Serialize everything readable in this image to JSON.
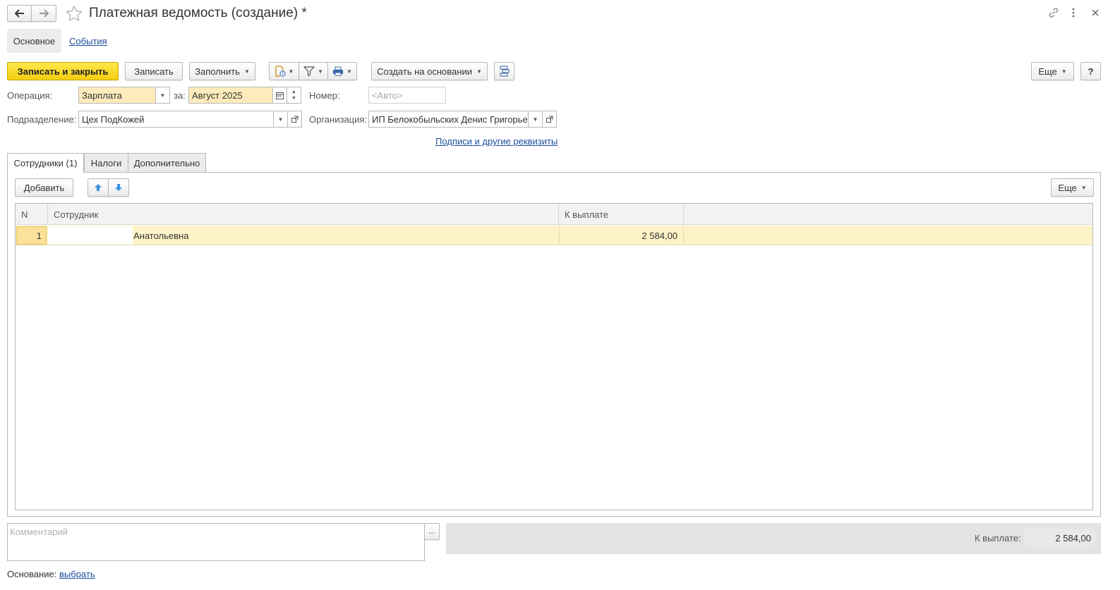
{
  "window": {
    "title": "Платежная ведомость (создание) *",
    "back_icon": "arrow-left-icon",
    "forward_icon": "arrow-right-icon",
    "favorite_icon": "star-icon",
    "link_icon": "link-icon",
    "more_icon": "vertical-dots-icon",
    "close_icon": "close-icon"
  },
  "nav_tabs": {
    "main": "Основное",
    "events": "События"
  },
  "toolbar": {
    "save_close": "Записать и закрыть",
    "save": "Записать",
    "fill": "Заполнить",
    "create_based": "Создать на основании",
    "more": "Еще",
    "help": "?"
  },
  "form": {
    "operation_label": "Операция:",
    "operation_value": "Зарплата",
    "period_label": "за:",
    "period_value": "Август 2025",
    "number_label": "Номер:",
    "number_placeholder": "<Авто>",
    "department_label": "Подразделение:",
    "department_value": "Цех ПодКожей",
    "organization_label": "Организация:",
    "organization_value": "ИП Белокобыльских Денис Григорье",
    "signatures_link": "Подписи и другие реквизиты"
  },
  "tabs": [
    "Сотрудники (1)",
    "Налоги",
    "Дополнительно"
  ],
  "table_toolbar": {
    "add": "Добавить",
    "more": "Еще"
  },
  "table": {
    "headers": {
      "n": "N",
      "employee": "Сотрудник",
      "to_pay": "К выплате"
    },
    "rows": [
      {
        "n": "1",
        "employee": "Анатольевна",
        "to_pay": "2 584,00"
      }
    ]
  },
  "footer": {
    "comment_placeholder": "Комментарий",
    "comment_button": "...",
    "total_label": "К выплате:",
    "total_value": "2 584,00",
    "basis_label": "Основание:",
    "basis_link": "выбрать"
  },
  "colors": {
    "primary": "#f4cd12",
    "selected_row": "#fdf3c6",
    "link": "#1c4e9c",
    "footer_bar": "#e3e3e3"
  }
}
